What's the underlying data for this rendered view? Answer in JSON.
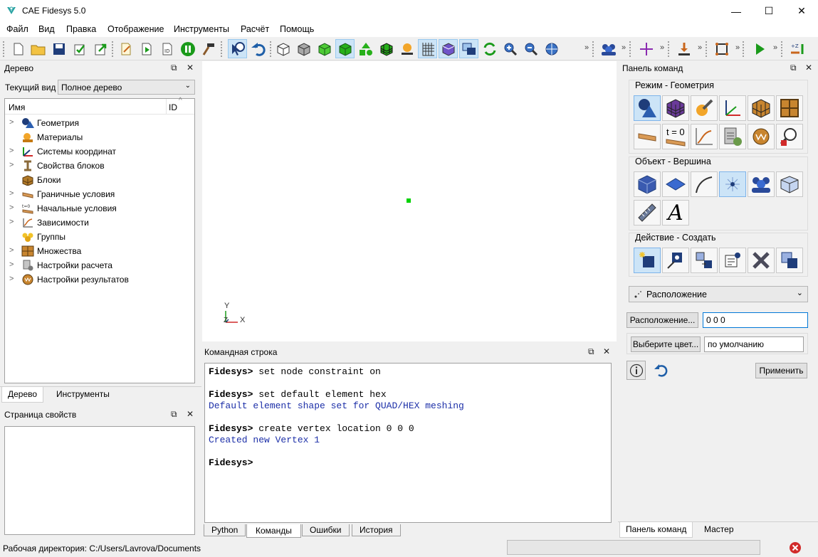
{
  "window": {
    "title": "CAE Fidesys 5.0",
    "minimize": "—",
    "maximize": "☐",
    "close": "✕"
  },
  "menu": [
    "Файл",
    "Вид",
    "Правка",
    "Отображение",
    "Инструменты",
    "Расчёт",
    "Помощь"
  ],
  "tree_panel": {
    "title": "Дерево",
    "view_label": "Текущий вид",
    "view_value": "Полное дерево",
    "col_name": "Имя",
    "col_id": "ID",
    "items": [
      {
        "label": "Геометрия",
        "icon": "geometry-icon"
      },
      {
        "label": "Материалы",
        "icon": "materials-icon"
      },
      {
        "label": "Системы координат",
        "icon": "coordinate-systems-icon"
      },
      {
        "label": "Свойства блоков",
        "icon": "block-properties-icon"
      },
      {
        "label": "Блоки",
        "icon": "blocks-icon"
      },
      {
        "label": "Граничные условия",
        "icon": "boundary-conditions-icon"
      },
      {
        "label": "Начальные условия",
        "icon": "initial-conditions-icon"
      },
      {
        "label": "Зависимости",
        "icon": "dependencies-icon"
      },
      {
        "label": "Группы",
        "icon": "groups-icon"
      },
      {
        "label": "Множества",
        "icon": "sets-icon"
      },
      {
        "label": "Настройки расчета",
        "icon": "analysis-settings-icon"
      },
      {
        "label": "Настройки результатов",
        "icon": "results-settings-icon"
      }
    ],
    "tabs": [
      "Дерево",
      "Инструменты"
    ]
  },
  "props_panel": {
    "title": "Страница свойств"
  },
  "viewport": {
    "axis_y": "Y",
    "axis_z": "Z",
    "axis_x": "X"
  },
  "console": {
    "title": "Командная строка",
    "lines": [
      {
        "prompt": "Fidesys>",
        "text": " set node constraint on"
      },
      {
        "prompt": "Fidesys>",
        "text": " set default element hex"
      },
      {
        "text": "Default element shape set for QUAD/HEX meshing"
      },
      {
        "prompt": "Fidesys>",
        "text": " create vertex location 0 0 0"
      },
      {
        "text": "Created new Vertex 1"
      },
      {
        "prompt": "Fidesys>",
        "text": ""
      }
    ],
    "tabs": [
      "Python",
      "Команды",
      "Ошибки",
      "История"
    ]
  },
  "command_panel": {
    "title": "Панель команд",
    "mode_label": "Режим - Геометрия",
    "object_label": "Объект - Вершина",
    "action_label": "Действие - Создать",
    "t0_label": "t = 0",
    "text_icon_label": "A",
    "dropdown_value": "Расположение",
    "location_button": "Расположение...",
    "location_value": "0 0 0",
    "color_button": "Выберите цвет...",
    "color_value": "по умолчанию",
    "apply_button": "Применить",
    "tabs": [
      "Панель команд",
      "Мастер"
    ]
  },
  "status": {
    "workdir": "Рабочая директория: C:/Users/Lavrova/Documents"
  },
  "colors": {
    "accent": "#0078d7",
    "vertex": "#00d200",
    "console_output": "#1c2fa8"
  }
}
